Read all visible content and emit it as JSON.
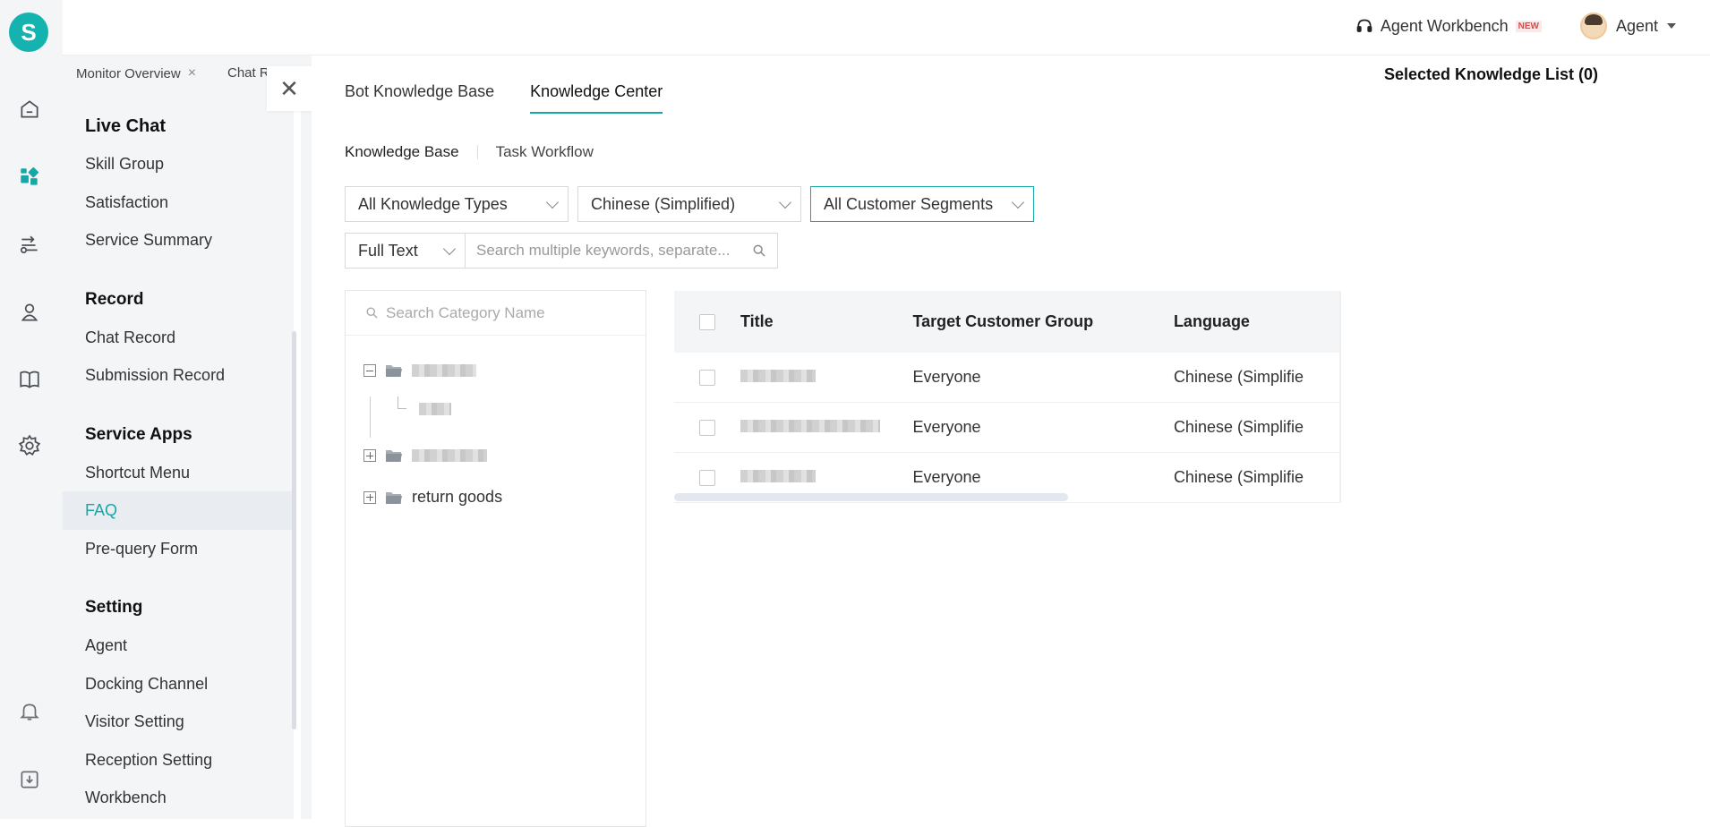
{
  "app": {
    "logo_letter": "S"
  },
  "rail_icons": [
    "home-icon",
    "dashboard-icon",
    "route-icon",
    "user-location-icon",
    "book-icon",
    "settings-icon",
    "bell-icon",
    "download-icon"
  ],
  "header": {
    "workbench_label": "Agent Workbench",
    "new_badge": "NEW",
    "agent_label": "Agent"
  },
  "open_tabs": [
    {
      "label": "Monitor Overview",
      "closable": true
    },
    {
      "label": "Chat R"
    }
  ],
  "sidebar": {
    "sections": [
      {
        "title": "Live Chat",
        "items": [
          "Skill Group",
          "Satisfaction",
          "Service Summary"
        ]
      },
      {
        "title": "Record",
        "items": [
          "Chat Record",
          "Submission Record"
        ]
      },
      {
        "title": "Service Apps",
        "items": [
          "Shortcut Menu",
          "FAQ",
          "Pre-query Form"
        ]
      },
      {
        "title": "Setting",
        "items": [
          "Agent",
          "Docking Channel",
          "Visitor Setting",
          "Reception Setting",
          "Workbench"
        ]
      }
    ],
    "active_item": "FAQ"
  },
  "main": {
    "top_tabs": [
      "Bot Knowledge Base",
      "Knowledge Center"
    ],
    "active_top_tab": "Knowledge Center",
    "sub_tabs": [
      "Knowledge Base",
      "Task Workflow"
    ],
    "filters": {
      "knowledge_type": "All Knowledge Types",
      "language": "Chinese (Simplified)",
      "customer_segment": "All Customer Segments"
    },
    "search": {
      "mode": "Full Text",
      "placeholder": "Search multiple keywords, separate..."
    },
    "tree": {
      "search_placeholder": "Search Category Name",
      "visible_node": "return goods"
    },
    "table": {
      "columns": [
        "Title",
        "Target Customer Group",
        "Language"
      ],
      "rows": [
        {
          "target": "Everyone",
          "language": "Chinese (Simplifie"
        },
        {
          "target": "Everyone",
          "language": "Chinese (Simplifie"
        },
        {
          "target": "Everyone",
          "language": "Chinese (Simplifie"
        }
      ]
    },
    "selected_list_title": "Selected Knowledge List (0)"
  },
  "colors": {
    "accent": "#15a8a6",
    "logo": "#15b3b0",
    "sidebar_bg": "#f4f5f7"
  }
}
